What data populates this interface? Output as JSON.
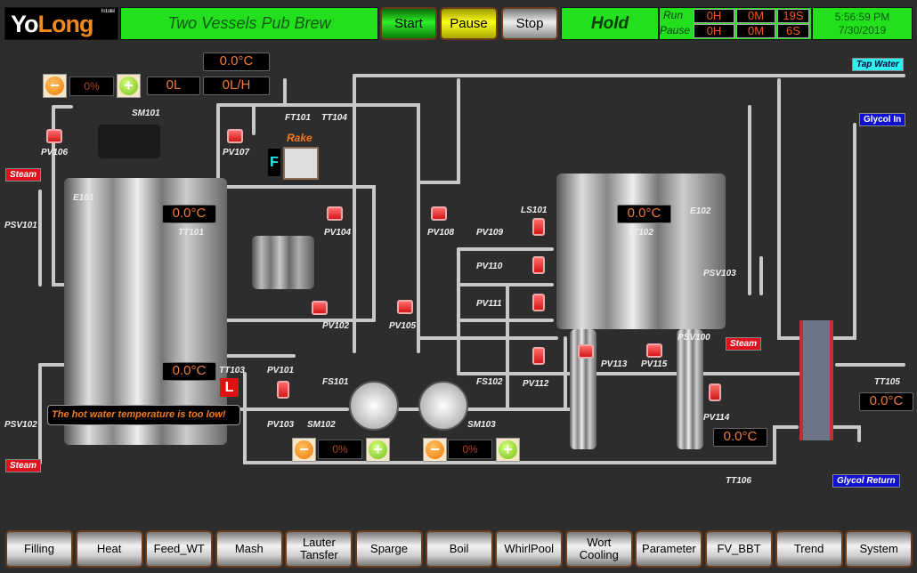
{
  "header": {
    "logo_main": "Yo",
    "logo_accent": "Long",
    "logo_small": "Industrial",
    "title": "Two Vessels Pub Brew",
    "start": "Start",
    "pause": "Pause",
    "stop": "Stop",
    "state": "Hold",
    "run_label": "Run",
    "pause_label": "Pause",
    "run": [
      "0H",
      "0M",
      "19S"
    ],
    "paused": [
      "0H",
      "0M",
      "6S"
    ],
    "time": "5:56:59 PM",
    "date": "7/30/2019"
  },
  "readouts": {
    "top_temp": "0.0°C",
    "volume": "0L",
    "flow": "0L/H",
    "pump101_pct": "0%",
    "tt101": "0.0°C",
    "tt102": "0.0°C",
    "tt103": "0.0°C",
    "tt105": "0.0°C",
    "tt106": "0.0°C",
    "sm102_pct": "0%",
    "sm103_pct": "0%"
  },
  "rake": {
    "label": "Rake",
    "mode": "F"
  },
  "level_badge": "L",
  "alarm": "The hot water temperature is too low!",
  "sources": {
    "tap_water": "Tap Water",
    "glycol_in": "Glycol In",
    "glycol_return": "Glycol Return",
    "steam": "Steam"
  },
  "tags": [
    "SM101",
    "PV106",
    "PV107",
    "FT101",
    "TT104",
    "E101",
    "TT101",
    "PSV101",
    "PV104",
    "PV108",
    "PV109",
    "PV110",
    "PV111",
    "LS101",
    "TT102",
    "E102",
    "PSV103",
    "PSV100",
    "PV102",
    "PV105",
    "PV101",
    "TT103",
    "FS101",
    "FS102",
    "PV112",
    "PV113",
    "PV115",
    "PV103",
    "SM102",
    "SM103",
    "PV114",
    "TT105",
    "TT106",
    "PSV102"
  ],
  "valves": [
    "PV106",
    "PV107",
    "PV104",
    "PV108",
    "PV109",
    "PV110",
    "PV111",
    "PV102",
    "PV105",
    "PV101",
    "PV112",
    "PV113",
    "PV115",
    "PV114"
  ],
  "nav": [
    "Filling",
    "Heat",
    "Feed_WT",
    "Mash",
    "Lauter\nTansfer",
    "Sparge",
    "Boil",
    "WhirlPool",
    "Wort\nCooling",
    "Parameter",
    "FV_BBT",
    "Trend",
    "System"
  ],
  "colors": {
    "run_green": "#22e01c",
    "pause_yellow": "#ffff1a",
    "valve_red": "#e02020",
    "readout_orange": "#f07a3a",
    "glycol_blue": "#1010d0",
    "tap_cyan": "#2ef0f0"
  }
}
